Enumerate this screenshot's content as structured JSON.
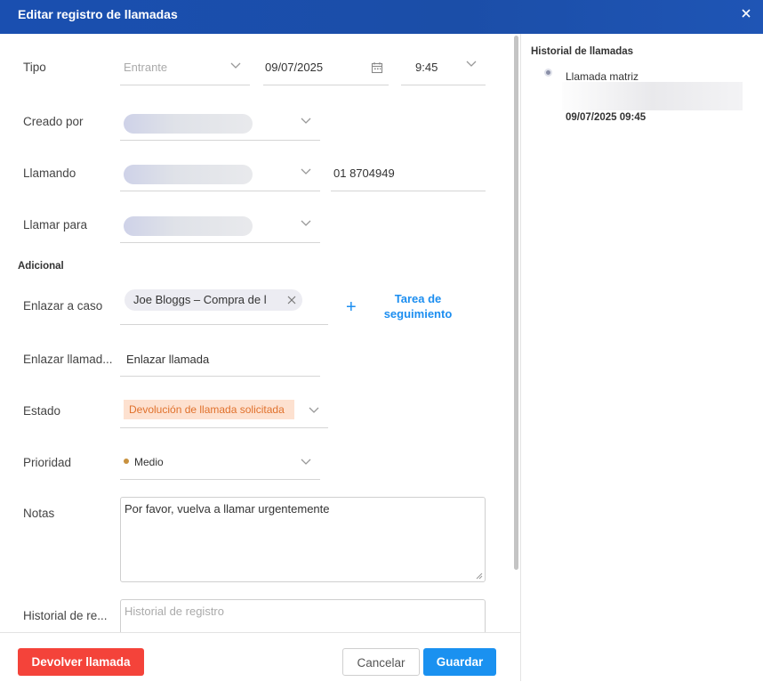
{
  "header": {
    "title": "Editar registro de llamadas"
  },
  "form": {
    "tipo": {
      "label": "Tipo",
      "value": "Entrante",
      "date": "09/07/2025",
      "time": "9:45"
    },
    "creado_por": {
      "label": "Creado por"
    },
    "llamando": {
      "label": "Llamando",
      "phone": "01 8704949"
    },
    "llamar_para": {
      "label": "Llamar para"
    },
    "section_adicional": "Adicional",
    "enlazar_caso": {
      "label": "Enlazar a caso",
      "chip": "Joe Bloggs – Compra de l"
    },
    "follow_up": {
      "plus": "+",
      "label_line1": "Tarea de",
      "label_line2": "seguimiento"
    },
    "enlazar_llamada": {
      "label": "Enlazar llamad...",
      "value": "Enlazar llamada"
    },
    "estado": {
      "label": "Estado",
      "value": "Devolución de llamada solicitada"
    },
    "prioridad": {
      "label": "Prioridad",
      "value": "Medio"
    },
    "notas": {
      "label": "Notas",
      "value": "Por favor, vuelva a llamar urgentemente"
    },
    "historial": {
      "label": "Historial de re...",
      "placeholder": "Historial de registro"
    }
  },
  "footer": {
    "return_call": "Devolver llamada",
    "cancel": "Cancelar",
    "save": "Guardar"
  },
  "sidebar": {
    "title": "Historial de llamadas",
    "entry": {
      "title": "Llamada matriz",
      "datetime": "09/07/2025 09:45"
    }
  },
  "colors": {
    "header": "#1a4fb0",
    "accent": "#1a91f0",
    "danger": "#f4433a",
    "status_bg": "#fde1d0",
    "status_text": "#e0712c"
  }
}
